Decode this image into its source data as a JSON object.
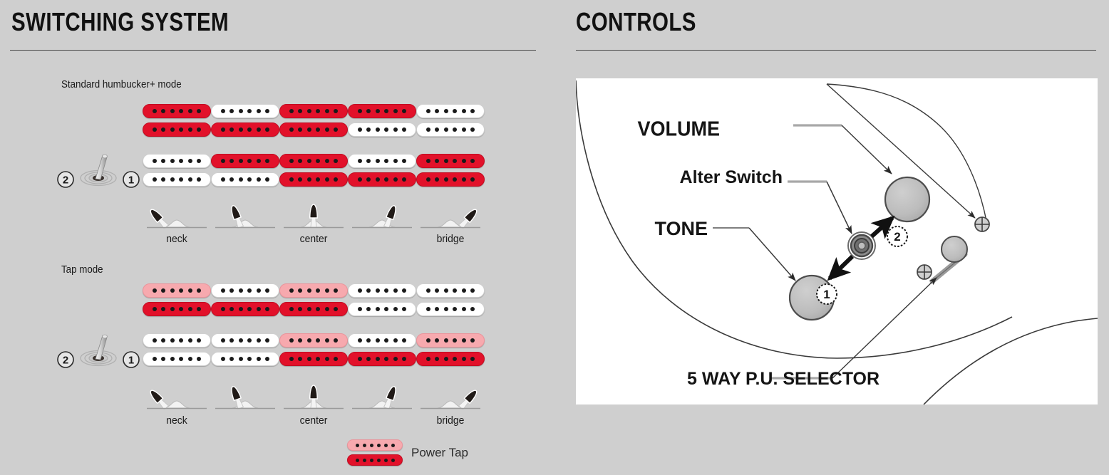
{
  "switching": {
    "title": "SWITCHING SYSTEM",
    "modes": [
      {
        "id": "standard",
        "label": "Standard humbucker+ mode",
        "toggle": {
          "left_label": "2",
          "right_label": "1"
        },
        "columns": [
          {
            "position_label": "neck",
            "lever": "left-full",
            "row_top": [
              "red",
              "red"
            ],
            "row_bottom": [
              "white",
              "white"
            ]
          },
          {
            "position_label": "",
            "lever": "left-half",
            "row_top": [
              "white",
              "red"
            ],
            "row_bottom": [
              "red",
              "white"
            ]
          },
          {
            "position_label": "center",
            "lever": "center",
            "row_top": [
              "red",
              "red"
            ],
            "row_bottom": [
              "red",
              "red"
            ]
          },
          {
            "position_label": "",
            "lever": "right-half",
            "row_top": [
              "red",
              "white"
            ],
            "row_bottom": [
              "white",
              "red"
            ]
          },
          {
            "position_label": "bridge",
            "lever": "right-full",
            "row_top": [
              "white",
              "white"
            ],
            "row_bottom": [
              "red",
              "red"
            ]
          }
        ]
      },
      {
        "id": "tap",
        "label": "Tap mode",
        "toggle": {
          "left_label": "2",
          "right_label": "1"
        },
        "columns": [
          {
            "position_label": "neck",
            "lever": "left-full",
            "row_top": [
              "pink",
              "red"
            ],
            "row_bottom": [
              "white",
              "white"
            ]
          },
          {
            "position_label": "",
            "lever": "left-half",
            "row_top": [
              "white",
              "red"
            ],
            "row_bottom": [
              "white",
              "white"
            ]
          },
          {
            "position_label": "center",
            "lever": "center",
            "row_top": [
              "pink",
              "red"
            ],
            "row_bottom": [
              "pink",
              "red"
            ]
          },
          {
            "position_label": "",
            "lever": "right-half",
            "row_top": [
              "white",
              "white"
            ],
            "row_bottom": [
              "white",
              "red"
            ]
          },
          {
            "position_label": "bridge",
            "lever": "right-full",
            "row_top": [
              "white",
              "white"
            ],
            "row_bottom": [
              "pink",
              "red"
            ]
          }
        ]
      }
    ],
    "legend": {
      "label": "Power Tap",
      "coils": [
        "pink",
        "red"
      ]
    }
  },
  "controls": {
    "title": "CONTROLS",
    "labels": {
      "volume": "VOLUME",
      "alter_switch": "Alter Switch",
      "tone": "TONE",
      "selector": "5 WAY P.U. SELECTOR",
      "alter_pos_1": "1",
      "alter_pos_2": "2"
    }
  },
  "colors": {
    "background": "#cfcfcf",
    "red": "#e2112a",
    "pink": "#f7a9ae",
    "white": "#ffffff",
    "pole": "#1a1a1a",
    "text": "#111111",
    "divider": "#4a4a4a"
  }
}
